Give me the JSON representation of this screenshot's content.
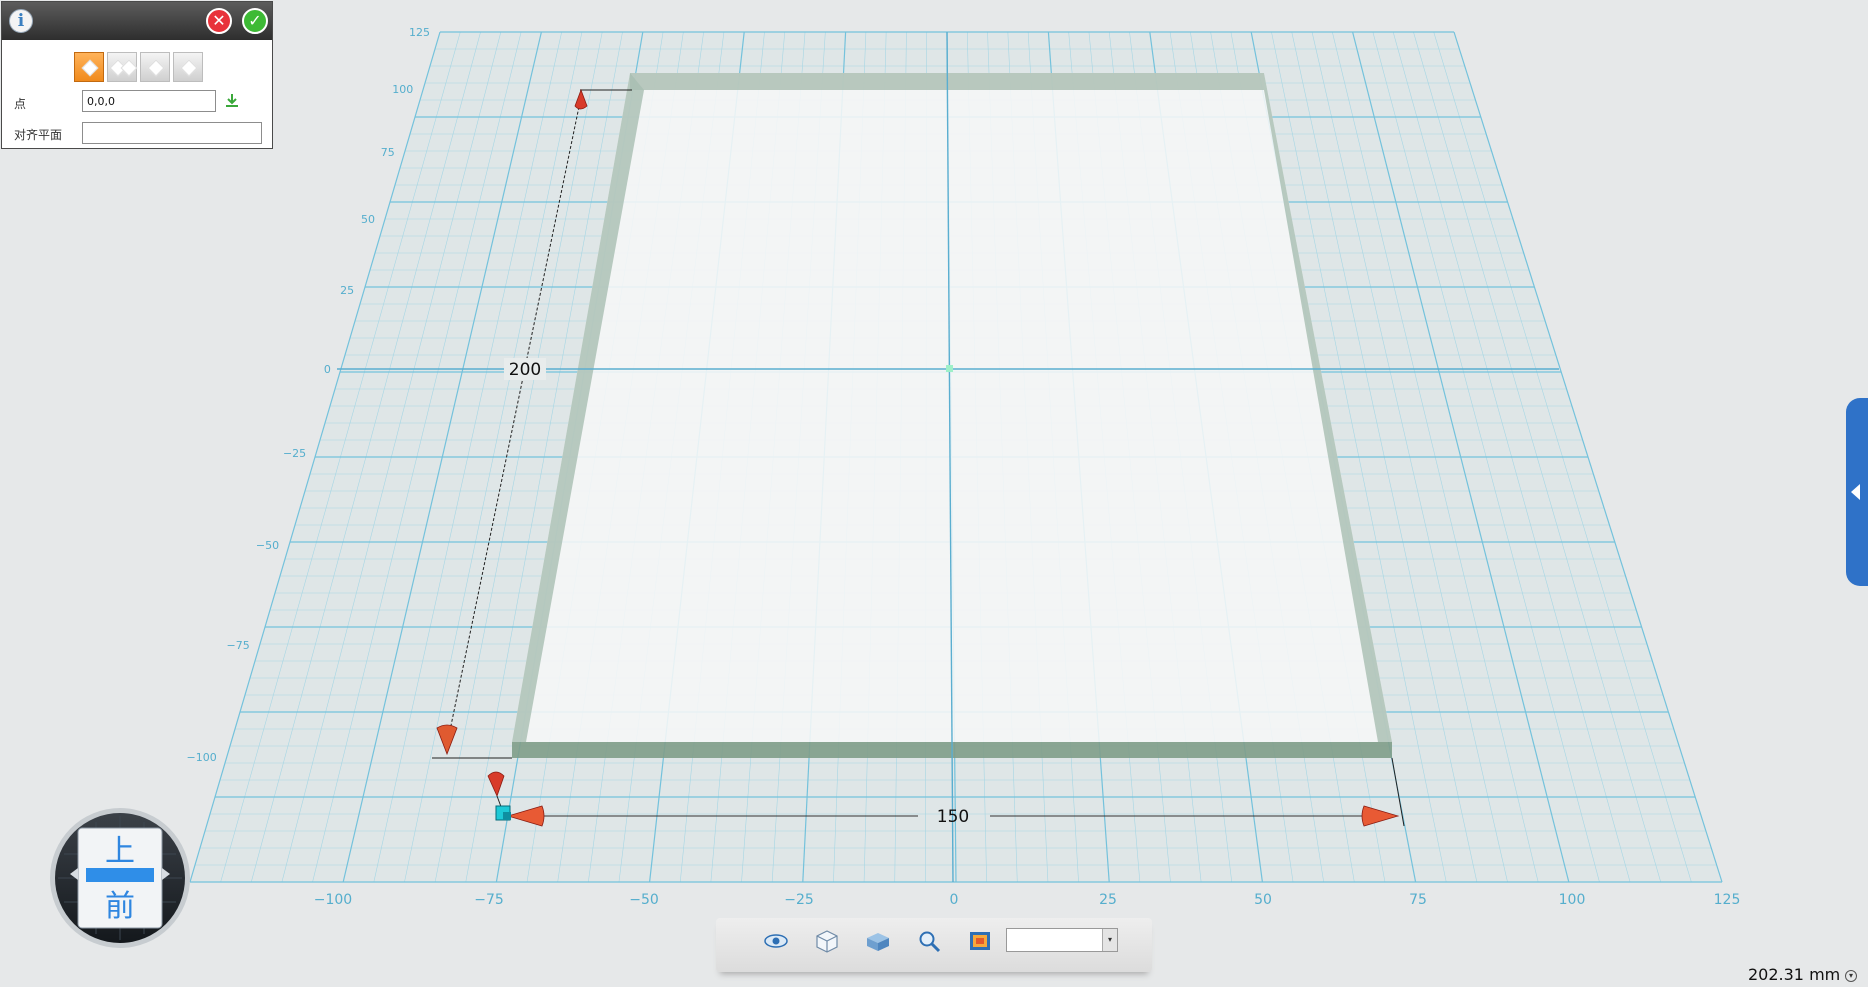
{
  "viewport": {
    "grid_ticks_y": [
      "125",
      "100",
      "75",
      "50",
      "25",
      "0",
      "−25",
      "−50",
      "−75",
      "−100"
    ],
    "grid_ticks_x": [
      "−100",
      "−75",
      "−50",
      "−25",
      "0",
      "25",
      "50",
      "75",
      "100",
      "125"
    ],
    "dimension_length": "200",
    "dimension_width": "150",
    "grid_color": "#7cc7de",
    "handle_color": "#e0402a"
  },
  "panel": {
    "info_icon": "i",
    "cancel_icon": "✕",
    "confirm_icon": "✓",
    "point_label": "点",
    "point_value": "0,0,0",
    "plane_label": "对齐平面",
    "plane_value": ""
  },
  "view_cube": {
    "top_label": "上",
    "front_label": "前"
  },
  "toolbar": {
    "select_value": "",
    "select_arrow": "▾"
  },
  "status": {
    "measurement": "202.31 mm",
    "chevron": "▾"
  }
}
